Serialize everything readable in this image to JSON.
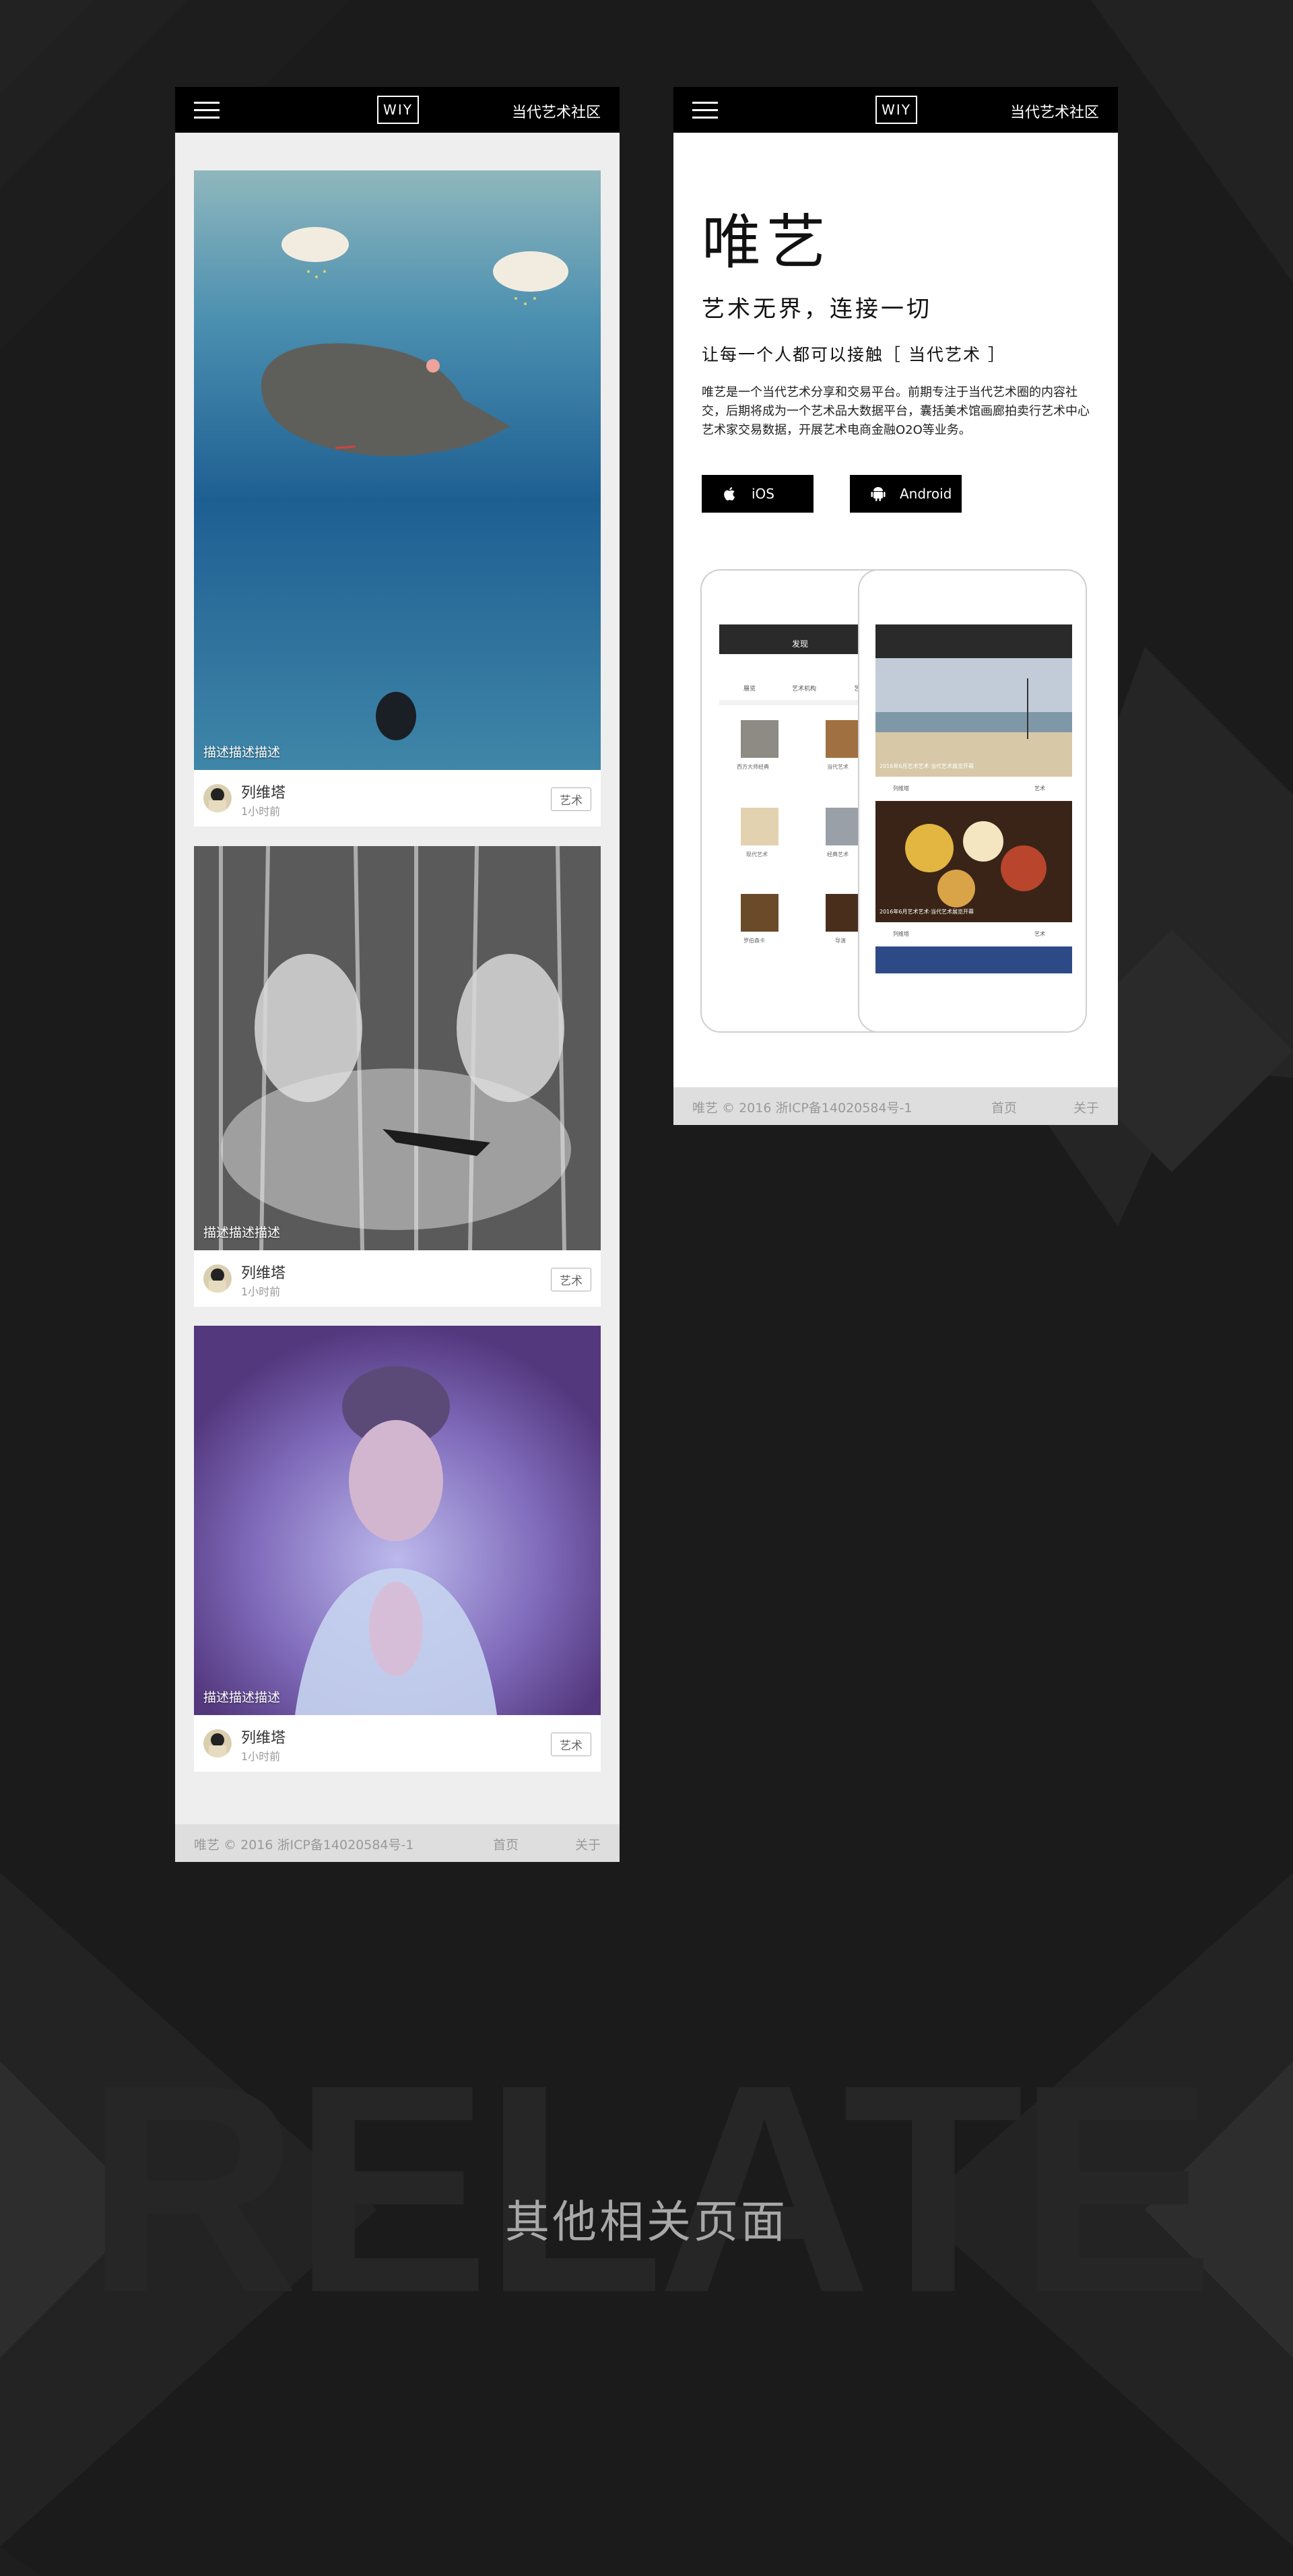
{
  "brand": {
    "logo_text": "WIY",
    "nav_title": "当代艺术社区"
  },
  "feed": {
    "cards": [
      {
        "caption": "描述描述描述",
        "author": "列维塔",
        "time": "1小时前",
        "tag": "艺术"
      },
      {
        "caption": "描述描述描述",
        "author": "列维塔",
        "time": "1小时前",
        "tag": "艺术"
      },
      {
        "caption": "描述描述描述",
        "author": "列维塔",
        "time": "1小时前",
        "tag": "艺术"
      }
    ]
  },
  "landing": {
    "title": "唯艺",
    "slogan": "艺术无界，连接一切",
    "subtitle": "让每一个人都可以接触［ 当代艺术 ］",
    "description": "唯艺是一个当代艺术分享和交易平台。前期专注于当代艺术圈的内容社交，后期将成为一个艺术品大数据平台，囊括美术馆画廊拍卖行艺术中心艺术家交易数据，开展艺术电商金融O2O等业务。",
    "ios_label": "iOS",
    "android_label": "Android",
    "mock_left": {
      "header": "发现",
      "categories": [
        "展览",
        "艺术机构",
        "艺"
      ],
      "grid_labels": [
        "西方大师经典",
        "当代艺术",
        "现代艺术",
        "经典艺术",
        "罗伯森卡",
        "导演"
      ]
    },
    "mock_right": {
      "card1_caption": "2016年6月艺术艺术·当代艺术展览开幕",
      "card2_caption": "2016年6月艺术艺术·当代艺术展览开幕",
      "author": "列维塔",
      "tag": "艺术"
    }
  },
  "footer": {
    "copyright": "唯艺 © 2016 浙ICP备14020584号-1",
    "link_home": "首页",
    "link_about": "关于"
  },
  "related": {
    "watermark": "RELATE",
    "title": "其他相关页面"
  }
}
